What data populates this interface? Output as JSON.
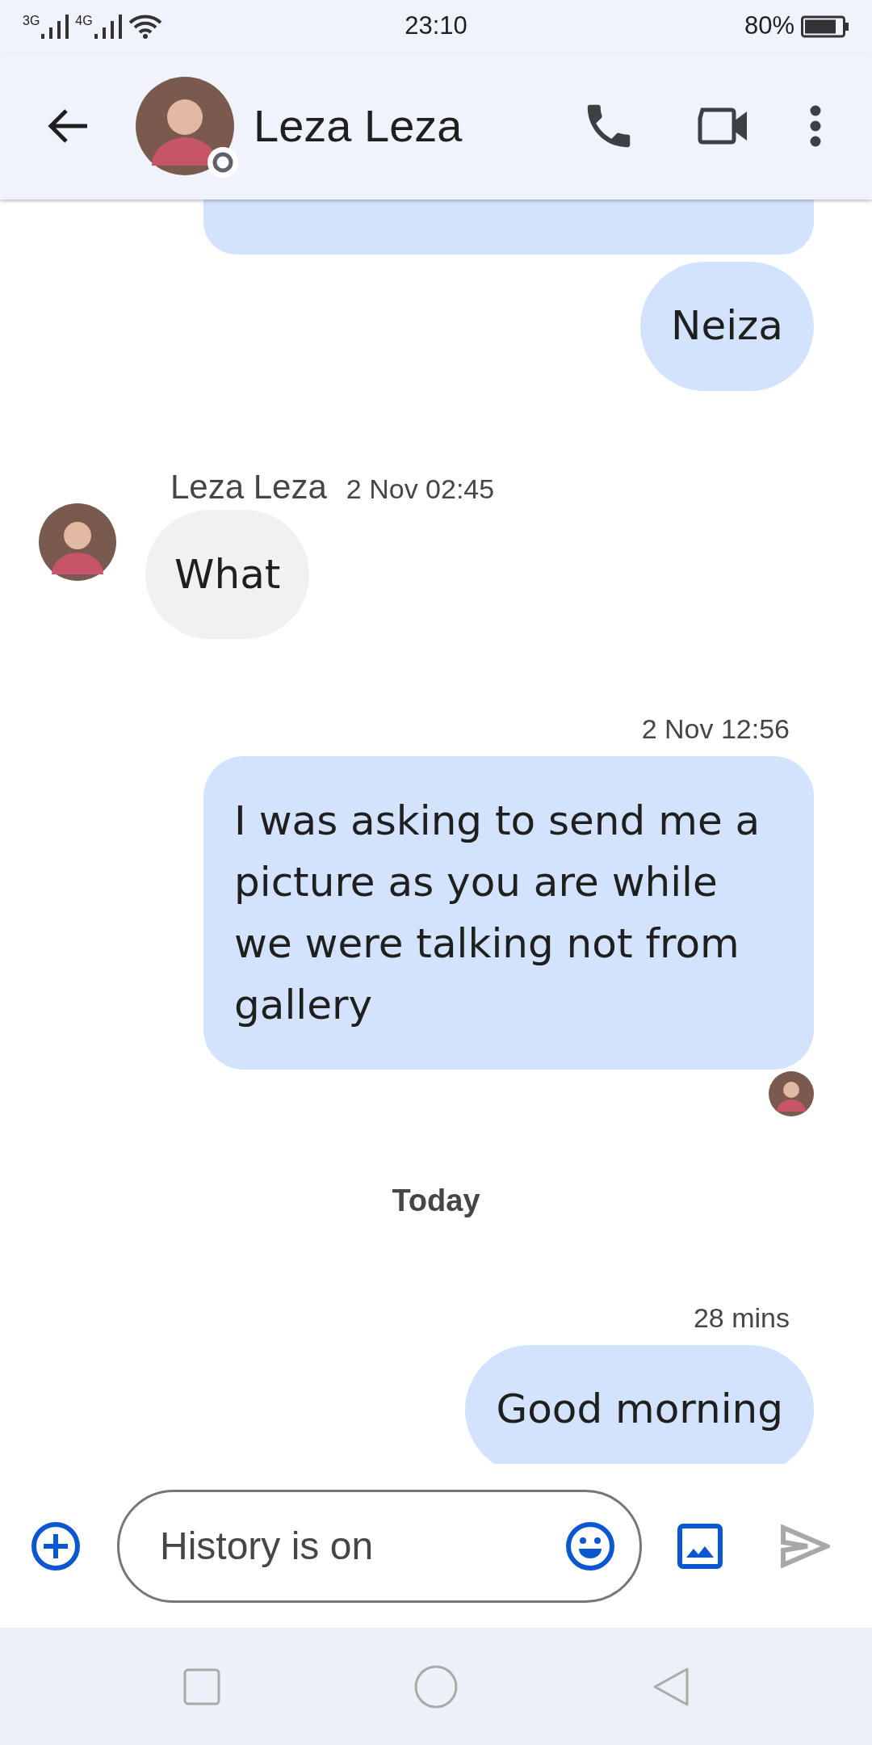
{
  "status_bar": {
    "network_labels": [
      "3G",
      "4G"
    ],
    "time": "23:10",
    "battery": "80%"
  },
  "header": {
    "contact_name": "Leza Leza"
  },
  "messages": [
    {
      "kind": "clipped"
    },
    {
      "kind": "outgoing",
      "text": "Neiza"
    },
    {
      "kind": "incoming",
      "sender": "Leza Leza",
      "time": "2 Nov 02:45",
      "text": "What"
    },
    {
      "kind": "outgoing",
      "time": "2 Nov 12:56",
      "text": "I was asking to send me a picture as you are while we were talking not from gallery",
      "read": true
    },
    {
      "kind": "divider",
      "text": "Today"
    },
    {
      "kind": "outgoing",
      "time": "28 mins",
      "text": "Good morning"
    }
  ],
  "composer": {
    "placeholder": "History is on"
  }
}
